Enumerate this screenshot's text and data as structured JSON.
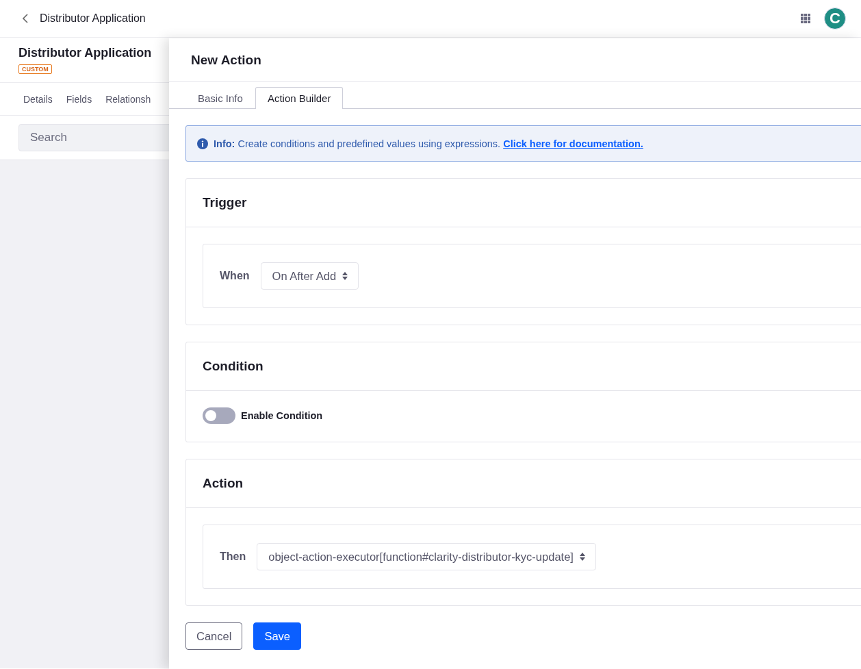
{
  "top_bar": {
    "title": "Distributor Application",
    "avatar": "C"
  },
  "object": {
    "title": "Distributor Application",
    "badge": "CUSTOM",
    "tabs": [
      {
        "label": "Details",
        "selected": false
      },
      {
        "label": "Fields",
        "selected": false
      },
      {
        "label": "Relationsh",
        "selected": false
      }
    ],
    "search": {
      "placeholder": "Search"
    }
  },
  "panel": {
    "title": "New Action",
    "tabs": [
      {
        "label": "Basic Info",
        "selected": false
      },
      {
        "label": "Action Builder",
        "selected": true
      }
    ],
    "info": {
      "label": "Info:",
      "text": "Create conditions and predefined values using expressions.",
      "link": "Click here for documentation."
    },
    "sections": [
      {
        "kind": "select",
        "title": "Trigger",
        "label": "When",
        "value": "On After Add"
      },
      {
        "kind": "toggle",
        "title": "Condition",
        "label": "Enable Condition",
        "on": false
      },
      {
        "kind": "select",
        "title": "Action",
        "label": "Then",
        "value": "object-action-executor[function#clarity-distributor-kyc-update]"
      }
    ],
    "buttons": [
      {
        "label": "Cancel",
        "kind": "secondary"
      },
      {
        "label": "Save",
        "kind": "primary"
      }
    ]
  }
}
